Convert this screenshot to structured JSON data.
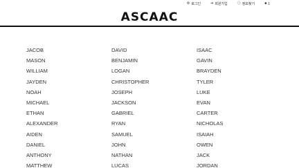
{
  "header": {
    "logo": "ASCAAC",
    "links": [
      {
        "icon": "gear-icon",
        "glyph": "⚙",
        "label": "로그인"
      },
      {
        "icon": "user-add-icon",
        "glyph": "➜",
        "label": "회원가입"
      },
      {
        "icon": "info-icon",
        "glyph": "ⓘ",
        "label": "정보찾기"
      },
      {
        "icon": "chat-icon",
        "glyph": "■",
        "label": "1"
      }
    ]
  },
  "names": {
    "col1": [
      "JACOB",
      "MASON",
      "WILLIAM",
      "JAYDEN",
      "NOAH",
      "MICHAEL",
      "ETHAN",
      "ALEXANDER",
      "AIDEN",
      "DANIEL",
      "ANTHONY",
      "MATTHEW"
    ],
    "col2": [
      "DAVID",
      "BENJAMIN",
      "LOGAN",
      "CHRISTOPHER",
      "JOSEPH",
      "JACKSON",
      "GABRIEL",
      "RYAN",
      "SAMUEL",
      "JOHN",
      "NATHAN",
      "LUCAS"
    ],
    "col3": [
      "ISAAC",
      "GAVIN",
      "BRAYDEN",
      "TYLER",
      "LUKE",
      "EVAN",
      "CARTER",
      "NICHOLAS",
      "ISAIAH",
      "OWEN",
      "JACK",
      "JORDAN"
    ]
  }
}
